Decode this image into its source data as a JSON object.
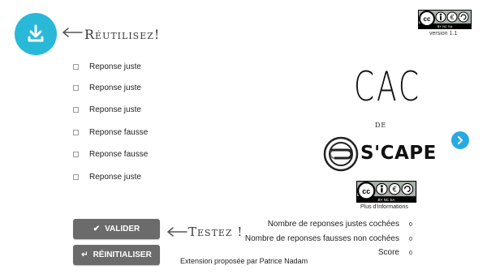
{
  "download": {
    "icon": "download-icon"
  },
  "reuse": {
    "text": "Réutilisez!"
  },
  "license_top": {
    "badge_text": "BY NC SA",
    "version": "version 1.1"
  },
  "checklist": [
    {
      "label": "Reponse juste"
    },
    {
      "label": "Reponse juste"
    },
    {
      "label": "Reponse juste"
    },
    {
      "label": "Reponse fausse"
    },
    {
      "label": "Reponse fausse"
    },
    {
      "label": "Reponse juste"
    }
  ],
  "title": {
    "main": "CAC",
    "connector": "de",
    "brand": "S'CAPE"
  },
  "navigation": {
    "next_icon": "chevron-right-icon"
  },
  "license_mid": {
    "badge_text": "BY NC SA",
    "more_info": "Plus d'informations"
  },
  "actions": {
    "validate_label": "VALIDER",
    "validate_icon": "check-icon",
    "reset_label": "RÉINITIALISER",
    "reset_icon": "reset-icon"
  },
  "test_hint": {
    "text": "Testez !"
  },
  "stats": [
    {
      "label": "Nombre de reponses justes cochées",
      "value": "0"
    },
    {
      "label": "Nombre de reponses fausses non cochées",
      "value": "0"
    },
    {
      "label": "Score",
      "value": "0"
    }
  ],
  "credit": "Extension proposée par Patrice Nadam",
  "colors": {
    "accent": "#29b8d8",
    "button": "#6b6b6b",
    "next": "#29a9e1"
  }
}
